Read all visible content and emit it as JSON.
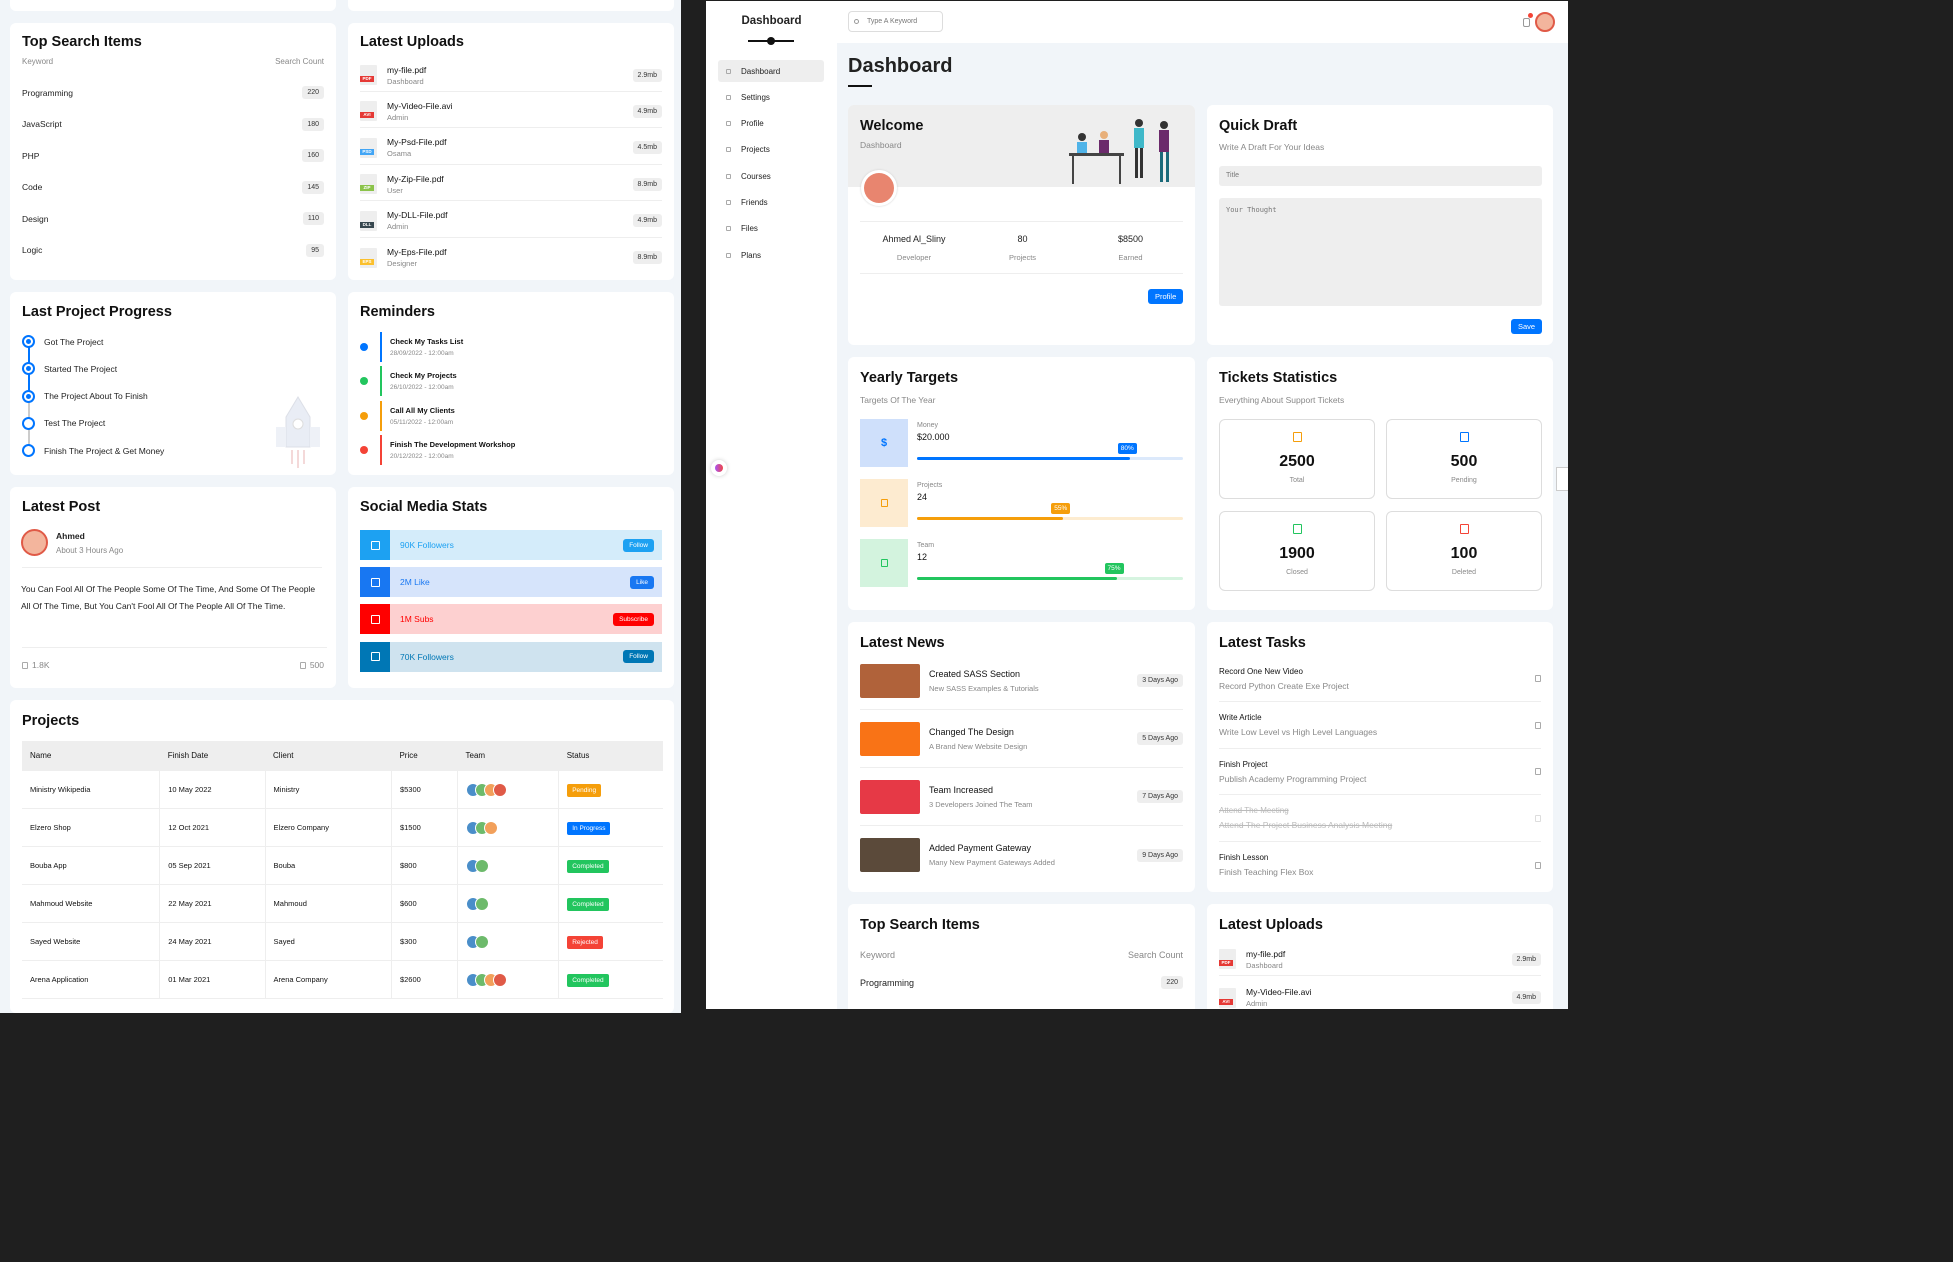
{
  "left": {
    "top_search": {
      "title": "Top Search Items",
      "col_keyword": "Keyword",
      "col_count": "Search Count",
      "rows": [
        {
          "keyword": "Programming",
          "count": "220"
        },
        {
          "keyword": "JavaScript",
          "count": "180"
        },
        {
          "keyword": "PHP",
          "count": "160"
        },
        {
          "keyword": "Code",
          "count": "145"
        },
        {
          "keyword": "Design",
          "count": "110"
        },
        {
          "keyword": "Logic",
          "count": "95"
        }
      ]
    },
    "uploads": {
      "title": "Latest Uploads",
      "items": [
        {
          "name": "my-file.pdf",
          "owner": "Dashboard",
          "size": "2.9mb",
          "ext": "PDF",
          "color": "#e53935"
        },
        {
          "name": "My-Video-File.avi",
          "owner": "Admin",
          "size": "4.9mb",
          "ext": "AVI",
          "color": "#e53935"
        },
        {
          "name": "My-Psd-File.pdf",
          "owner": "Osama",
          "size": "4.5mb",
          "ext": "PSD",
          "color": "#42a5f5"
        },
        {
          "name": "My-Zip-File.pdf",
          "owner": "User",
          "size": "8.9mb",
          "ext": "ZIP",
          "color": "#8bc34a"
        },
        {
          "name": "My-DLL-File.pdf",
          "owner": "Admin",
          "size": "4.9mb",
          "ext": "DLL",
          "color": "#37474f"
        },
        {
          "name": "My-Eps-File.pdf",
          "owner": "Designer",
          "size": "8.9mb",
          "ext": "EPS",
          "color": "#fbc02d"
        }
      ]
    },
    "progress": {
      "title": "Last Project Progress",
      "steps": [
        {
          "label": "Got The Project",
          "done": true
        },
        {
          "label": "Started The Project",
          "done": true
        },
        {
          "label": "The Project About To Finish",
          "done": true
        },
        {
          "label": "Test The Project",
          "done": false
        },
        {
          "label": "Finish The Project & Get Money",
          "done": false
        }
      ]
    },
    "reminders": {
      "title": "Reminders",
      "items": [
        {
          "title": "Check My Tasks List",
          "date": "28/09/2022 - 12:00am",
          "color": "#0075ff"
        },
        {
          "title": "Check My Projects",
          "date": "26/10/2022 - 12:00am",
          "color": "#22c55e"
        },
        {
          "title": "Call All My Clients",
          "date": "05/11/2022 - 12:00am",
          "color": "#f59e0b"
        },
        {
          "title": "Finish The Development Workshop",
          "date": "20/12/2022 - 12:00am",
          "color": "#f44336"
        }
      ]
    },
    "post": {
      "title": "Latest Post",
      "author": "Ahmed",
      "time": "About 3 Hours Ago",
      "body": "You Can Fool All Of The People Some Of The Time, And Some Of The People All Of The Time, But You Can't Fool All Of The People All Of The Time.",
      "likes": "1.8K",
      "comments": "500"
    },
    "social": {
      "title": "Social Media Stats",
      "items": [
        {
          "text": "90K Followers",
          "button": "Follow",
          "bg": "#d4ecfa",
          "icon_bg": "#1da1f2",
          "color": "#1da1f2"
        },
        {
          "text": "2M Like",
          "button": "Like",
          "bg": "#d6e4fb",
          "icon_bg": "#1877f2",
          "color": "#1877f2"
        },
        {
          "text": "1M Subs",
          "button": "Subscribe",
          "bg": "#fdd0d0",
          "icon_bg": "#ff0000",
          "color": "#ff0000"
        },
        {
          "text": "70K Followers",
          "button": "Follow",
          "bg": "#cfe3ef",
          "icon_bg": "#0077b5",
          "color": "#0077b5"
        }
      ]
    },
    "projects": {
      "title": "Projects",
      "headers": [
        "Name",
        "Finish Date",
        "Client",
        "Price",
        "Team",
        "Status"
      ],
      "rows": [
        {
          "name": "Ministry Wikipedia",
          "date": "10 May 2022",
          "client": "Ministry",
          "price": "$5300",
          "team": 4,
          "status": "Pending",
          "status_color": "#f59e0b"
        },
        {
          "name": "Elzero Shop",
          "date": "12 Oct 2021",
          "client": "Elzero Company",
          "price": "$1500",
          "team": 3,
          "status": "In Progress",
          "status_color": "#0075ff"
        },
        {
          "name": "Bouba App",
          "date": "05 Sep 2021",
          "client": "Bouba",
          "price": "$800",
          "team": 2,
          "status": "Completed",
          "status_color": "#22c55e"
        },
        {
          "name": "Mahmoud Website",
          "date": "22 May 2021",
          "client": "Mahmoud",
          "price": "$600",
          "team": 2,
          "status": "Completed",
          "status_color": "#22c55e"
        },
        {
          "name": "Sayed Website",
          "date": "24 May 2021",
          "client": "Sayed",
          "price": "$300",
          "team": 2,
          "status": "Rejected",
          "status_color": "#f44336"
        },
        {
          "name": "Arena Application",
          "date": "01 Mar 2021",
          "client": "Arena Company",
          "price": "$2600",
          "team": 4,
          "status": "Completed",
          "status_color": "#22c55e"
        }
      ]
    }
  },
  "right": {
    "sidebar": {
      "title": "Dashboard",
      "items": [
        "Dashboard",
        "Settings",
        "Profile",
        "Projects",
        "Courses",
        "Friends",
        "Files",
        "Plans"
      ]
    },
    "search_placeholder": "Type A Keyword",
    "page_title": "Dashboard",
    "welcome": {
      "title": "Welcome",
      "subtitle": "Dashboard",
      "name": "Ahmed Al_Sliny",
      "role": "Developer",
      "projects_val": "80",
      "projects_label": "Projects",
      "earned_val": "$8500",
      "earned_label": "Earned",
      "button": "Profile"
    },
    "draft": {
      "title": "Quick Draft",
      "subtitle": "Write A Draft For Your Ideas",
      "title_placeholder": "Title",
      "thought_placeholder": "Your Thought",
      "button": "Save"
    },
    "targets": {
      "title": "Yearly Targets",
      "subtitle": "Targets Of The Year",
      "items": [
        {
          "label": "Money",
          "value": "$20.000",
          "percent": 80,
          "percent_label": "80%",
          "icon": "$",
          "color": "#0075ff",
          "bg": "#cfe0fb",
          "track": "#dce9fb"
        },
        {
          "label": "Projects",
          "value": "24",
          "percent": 55,
          "percent_label": "55%",
          "icon": "",
          "color": "#f59e0b",
          "bg": "#fdebd0",
          "track": "#fdecd0"
        },
        {
          "label": "Team",
          "value": "12",
          "percent": 75,
          "percent_label": "75%",
          "icon": "",
          "color": "#22c55e",
          "bg": "#d3f3de",
          "track": "#d6f4e0"
        }
      ]
    },
    "tickets": {
      "title": "Tickets Statistics",
      "subtitle": "Everything About Support Tickets",
      "items": [
        {
          "num": "2500",
          "label": "Total",
          "color": "#f59e0b"
        },
        {
          "num": "500",
          "label": "Pending",
          "color": "#0075ff"
        },
        {
          "num": "1900",
          "label": "Closed",
          "color": "#22c55e"
        },
        {
          "num": "100",
          "label": "Deleted",
          "color": "#f44336"
        }
      ]
    },
    "news": {
      "title": "Latest News",
      "items": [
        {
          "title": "Created SASS Section",
          "sub": "New SASS Examples & Tutorials",
          "ago": "3 Days Ago",
          "img": "#b0623a"
        },
        {
          "title": "Changed The Design",
          "sub": "A Brand New Website Design",
          "ago": "5 Days Ago",
          "img": "#f97316"
        },
        {
          "title": "Team Increased",
          "sub": "3 Developers Joined The Team",
          "ago": "7 Days Ago",
          "img": "#e63946"
        },
        {
          "title": "Added Payment Gateway",
          "sub": "Many New Payment Gateways Added",
          "ago": "9 Days Ago",
          "img": "#5b4a3a"
        }
      ]
    },
    "tasks": {
      "title": "Latest Tasks",
      "items": [
        {
          "title": "Record One New Video",
          "sub": "Record Python Create Exe Project",
          "done": false
        },
        {
          "title": "Write Article",
          "sub": "Write Low Level vs High Level Languages",
          "done": false
        },
        {
          "title": "Finish Project",
          "sub": "Publish Academy Programming Project",
          "done": false
        },
        {
          "title": "Attend The Meeting",
          "sub": "Attend The Project Business Analysis Meeting",
          "done": true
        },
        {
          "title": "Finish Lesson",
          "sub": "Finish Teaching Flex Box",
          "done": false
        }
      ]
    },
    "top_search": {
      "title": "Top Search Items",
      "col_keyword": "Keyword",
      "col_count": "Search Count",
      "first_keyword": "Programming",
      "first_count": "220"
    },
    "uploads": {
      "title": "Latest Uploads",
      "items": [
        {
          "name": "my-file.pdf",
          "owner": "Dashboard",
          "size": "2.9mb",
          "ext": "PDF"
        },
        {
          "name": "My-Video-File.avi",
          "owner": "Admin",
          "size": "4.9mb",
          "ext": "AVI"
        }
      ]
    }
  }
}
